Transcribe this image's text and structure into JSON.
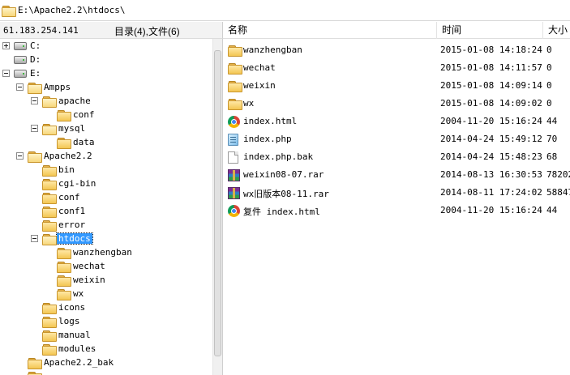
{
  "pathbar": {
    "path": "E:\\Apache2.2\\htdocs\\"
  },
  "infobar": {
    "ip": "61.183.254.141",
    "counts": "目录(4),文件(6)"
  },
  "columns": {
    "name": "名称",
    "time": "时间",
    "size": "大小"
  },
  "tree": {
    "items": [
      {
        "label": "C:",
        "icon": "drive-icon",
        "expander": "plus"
      },
      {
        "label": "D:",
        "icon": "drive-icon",
        "expander": "none"
      },
      {
        "label": "E:",
        "icon": "drive-icon",
        "expander": "minus"
      },
      {
        "label": "Ampps",
        "icon": "folder-icon",
        "expander": "minus"
      },
      {
        "label": "apache",
        "icon": "folder-icon",
        "expander": "minus"
      },
      {
        "label": "conf",
        "icon": "folder-icon",
        "expander": "none"
      },
      {
        "label": "mysql",
        "icon": "folder-icon",
        "expander": "minus"
      },
      {
        "label": "data",
        "icon": "folder-icon",
        "expander": "none"
      },
      {
        "label": "Apache2.2",
        "icon": "folder-icon",
        "expander": "minus"
      },
      {
        "label": "bin",
        "icon": "folder-icon",
        "expander": "none"
      },
      {
        "label": "cgi-bin",
        "icon": "folder-icon",
        "expander": "none"
      },
      {
        "label": "conf",
        "icon": "folder-icon",
        "expander": "none"
      },
      {
        "label": "conf1",
        "icon": "folder-icon",
        "expander": "none"
      },
      {
        "label": "error",
        "icon": "folder-icon",
        "expander": "none"
      },
      {
        "label": "htdocs",
        "icon": "folder-icon",
        "expander": "minus",
        "selected": true
      },
      {
        "label": "wanzhengban",
        "icon": "folder-icon",
        "expander": "none"
      },
      {
        "label": "wechat",
        "icon": "folder-icon",
        "expander": "none"
      },
      {
        "label": "weixin",
        "icon": "folder-icon",
        "expander": "none"
      },
      {
        "label": "wx",
        "icon": "folder-icon",
        "expander": "none"
      },
      {
        "label": "icons",
        "icon": "folder-icon",
        "expander": "none"
      },
      {
        "label": "logs",
        "icon": "folder-icon",
        "expander": "none"
      },
      {
        "label": "manual",
        "icon": "folder-icon",
        "expander": "none"
      },
      {
        "label": "modules",
        "icon": "folder-icon",
        "expander": "none"
      },
      {
        "label": "Apache2.2_bak",
        "icon": "folder-icon",
        "expander": "none"
      }
    ]
  },
  "files": [
    {
      "name": "wanzhengban",
      "time": "2015-01-08 14:18:24",
      "size": "0",
      "icon": "folder-icon"
    },
    {
      "name": "wechat",
      "time": "2015-01-08 14:11:57",
      "size": "0",
      "icon": "folder-icon"
    },
    {
      "name": "weixin",
      "time": "2015-01-08 14:09:14",
      "size": "0",
      "icon": "folder-icon"
    },
    {
      "name": "wx",
      "time": "2015-01-08 14:09:02",
      "size": "0",
      "icon": "folder-icon"
    },
    {
      "name": "index.html",
      "time": "2004-11-20 15:16:24",
      "size": "44",
      "icon": "chrome-icon"
    },
    {
      "name": "index.php",
      "time": "2014-04-24 15:49:12",
      "size": "70",
      "icon": "php-icon"
    },
    {
      "name": "index.php.bak",
      "time": "2014-04-24 15:48:23",
      "size": "68",
      "icon": "doc-icon"
    },
    {
      "name": "weixin08-07.rar",
      "time": "2014-08-13 16:30:53",
      "size": "78202",
      "icon": "rar-icon"
    },
    {
      "name": "wx旧版本08-11.rar",
      "time": "2014-08-11 17:24:02",
      "size": "58847",
      "icon": "rar-icon"
    },
    {
      "name": "复件 index.html",
      "time": "2004-11-20 15:16:24",
      "size": "44",
      "icon": "chrome-icon"
    }
  ]
}
